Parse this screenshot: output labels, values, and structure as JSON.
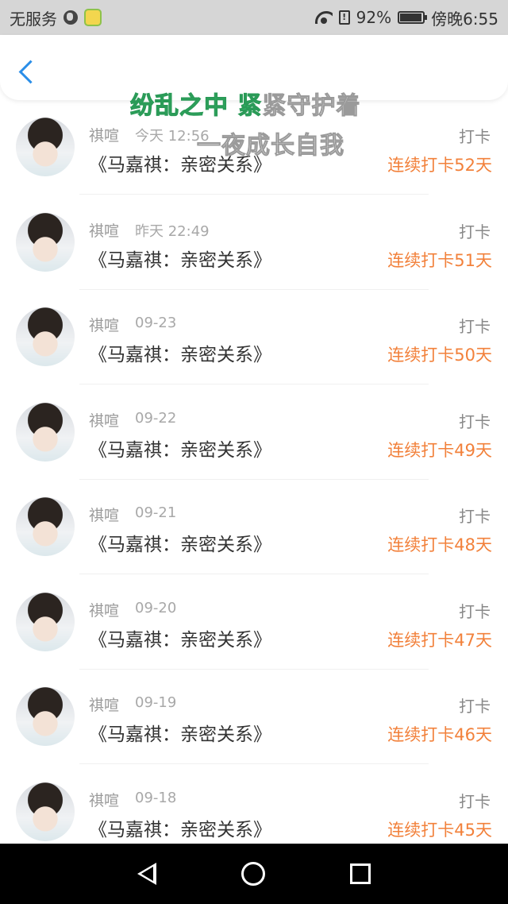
{
  "status_bar": {
    "carrier": "无服务",
    "sim_label": "!",
    "battery": "92%",
    "time": "傍晚6:55"
  },
  "lyrics": {
    "line1_highlight": "纷乱之中 紧",
    "line1_rest": "紧守护着",
    "line2": "一夜成长自我"
  },
  "records": [
    {
      "name": "祺喧",
      "time": "今天 12:56",
      "title": "《马嘉祺：亲密关系》",
      "action": "打卡",
      "streak": "连续打卡52天"
    },
    {
      "name": "祺喧",
      "time": "昨天 22:49",
      "title": "《马嘉祺：亲密关系》",
      "action": "打卡",
      "streak": "连续打卡51天"
    },
    {
      "name": "祺喧",
      "time": "09-23",
      "title": "《马嘉祺：亲密关系》",
      "action": "打卡",
      "streak": "连续打卡50天"
    },
    {
      "name": "祺喧",
      "time": "09-22",
      "title": "《马嘉祺：亲密关系》",
      "action": "打卡",
      "streak": "连续打卡49天"
    },
    {
      "name": "祺喧",
      "time": "09-21",
      "title": "《马嘉祺：亲密关系》",
      "action": "打卡",
      "streak": "连续打卡48天"
    },
    {
      "name": "祺喧",
      "time": "09-20",
      "title": "《马嘉祺：亲密关系》",
      "action": "打卡",
      "streak": "连续打卡47天"
    },
    {
      "name": "祺喧",
      "time": "09-19",
      "title": "《马嘉祺：亲密关系》",
      "action": "打卡",
      "streak": "连续打卡46天"
    },
    {
      "name": "祺喧",
      "time": "09-18",
      "title": "《马嘉祺：亲密关系》",
      "action": "打卡",
      "streak": "连续打卡45天"
    }
  ],
  "colors": {
    "accent_blue": "#2b8ee8",
    "streak_orange": "#f2813b",
    "lyric_green": "#37b86a"
  }
}
